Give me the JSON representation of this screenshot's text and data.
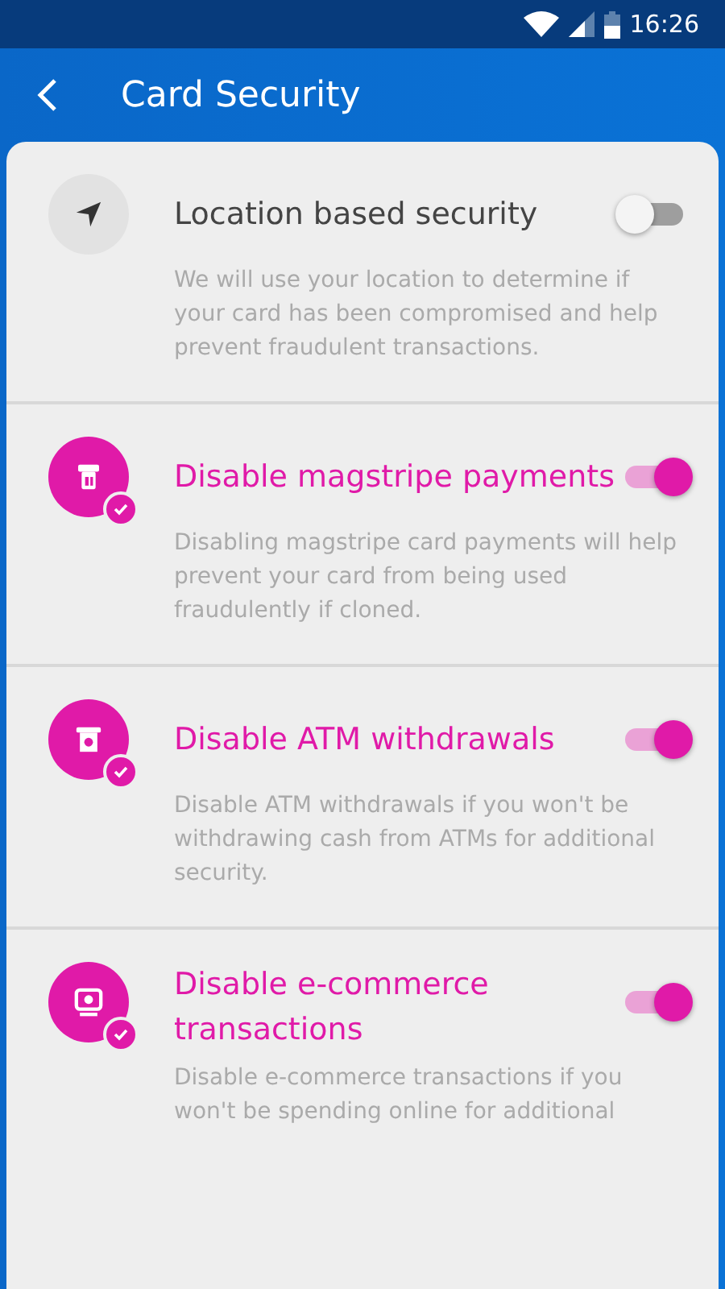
{
  "status_bar": {
    "time": "16:26"
  },
  "app_bar": {
    "title": "Card Security"
  },
  "settings": [
    {
      "kind": "location",
      "title": "Location based security",
      "description": "We will use your location to determine if your card has been compromised and help prevent fraudulent transactions.",
      "on": false
    },
    {
      "kind": "magstripe",
      "title": "Disable magstripe payments",
      "description": "Disabling magstripe card payments will help prevent your card from being used fraudulently if cloned.",
      "on": true
    },
    {
      "kind": "atm",
      "title": "Disable ATM withdrawals",
      "description": "Disable ATM withdrawals if you won't be withdrawing cash from ATMs for additional security.",
      "on": true
    },
    {
      "kind": "ecommerce",
      "title": "Disable e-commerce transactions",
      "description": "Disable e-commerce transactions if you won't be spending online for additional",
      "on": true
    }
  ]
}
